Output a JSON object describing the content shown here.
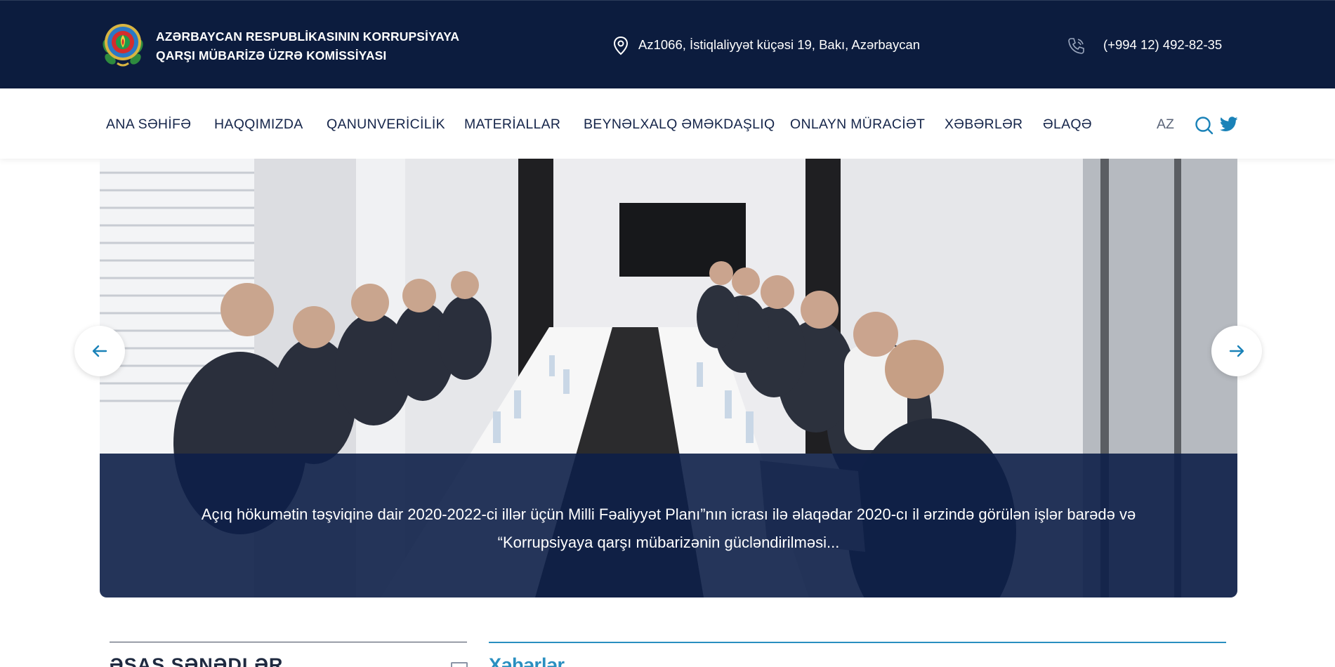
{
  "header": {
    "org_line1": "AZƏRBAYCAN RESPUBLİKASININ KORRUPSİYAYA",
    "org_line2": "QARŞI MÜBARİZƏ ÜZRƏ KOMİSSİYASI",
    "address": "Az1066, İstiqlaliyyət küçəsi 19, Bakı, Azərbaycan",
    "phone": "(+994 12) 492-82-35",
    "icons": [
      "emblem-icon",
      "location-pin-icon",
      "phone-icon"
    ]
  },
  "nav": {
    "items": [
      {
        "label": "ANA SƏHİFƏ"
      },
      {
        "label": "HAQQIMIZDA"
      },
      {
        "label": "QANUNVERİCİLİK"
      },
      {
        "label": "MATERİALLAR"
      },
      {
        "label": "BEYNƏLXALQ ƏMƏKDAŞLIQ"
      },
      {
        "label": "ONLAYN MÜRACİƏT"
      },
      {
        "label": "XƏBƏRLƏR"
      },
      {
        "label": "ƏLAQƏ"
      }
    ],
    "language": "AZ",
    "icons": [
      "search-icon",
      "twitter-icon"
    ]
  },
  "slider": {
    "caption_line1": "Açıq hökumətin təşviqinə dair 2020-2022-ci illər üçün Milli Fəaliyyət Planı”nın icrası ilə əlaqədar 2020-cı il ərzində görülən işlər barədə və",
    "caption_line2": "“Korrupsiyaya qarşı mübarizənin gücləndirilməsi...",
    "icons": [
      "arrow-left-icon",
      "arrow-right-icon"
    ]
  },
  "sections": {
    "documents_title": "ƏSAS SƏNƏDLƏR",
    "news_title": "Xəbərlər"
  },
  "colors": {
    "header_bg": "#0c1c3e",
    "nav_text": "#15254a",
    "accent": "#2a8fc0",
    "caption_bg": "#0d1f48"
  }
}
